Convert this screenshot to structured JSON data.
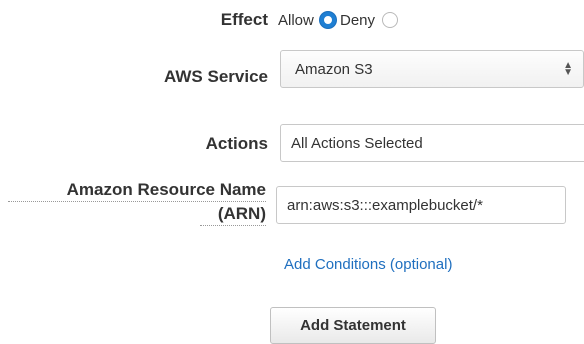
{
  "form": {
    "effect": {
      "label": "Effect",
      "options": [
        {
          "label": "Allow",
          "selected": true
        },
        {
          "label": "Deny",
          "selected": false
        }
      ]
    },
    "service": {
      "label": "AWS Service",
      "value": "Amazon S3"
    },
    "actions": {
      "label": "Actions",
      "value": "All Actions Selected"
    },
    "arn": {
      "label_line1": "Amazon Resource Name",
      "label_line2": "(ARN)",
      "value": "arn:aws:s3:::examplebucket/*"
    },
    "add_conditions_link": "Add Conditions (optional)",
    "add_statement_button": "Add Statement"
  },
  "colors": {
    "accent": "#1f7fd3",
    "link": "#1f6fbf"
  }
}
